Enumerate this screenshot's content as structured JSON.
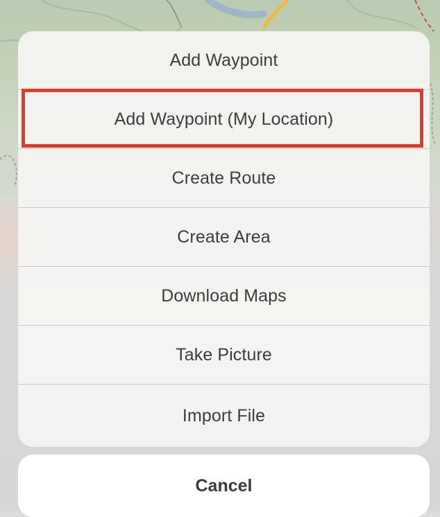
{
  "action_sheet": {
    "items": [
      {
        "label": "Add Waypoint"
      },
      {
        "label": "Add Waypoint (My Location)"
      },
      {
        "label": "Create Route"
      },
      {
        "label": "Create Area"
      },
      {
        "label": "Download Maps"
      },
      {
        "label": "Take Picture"
      },
      {
        "label": "Import File"
      }
    ],
    "cancel_label": "Cancel"
  },
  "colors": {
    "highlight_border": "#e03a2e",
    "map_road": "#f0b93a",
    "map_river": "#9fb6c9",
    "map_trail": "#c94a4a"
  }
}
